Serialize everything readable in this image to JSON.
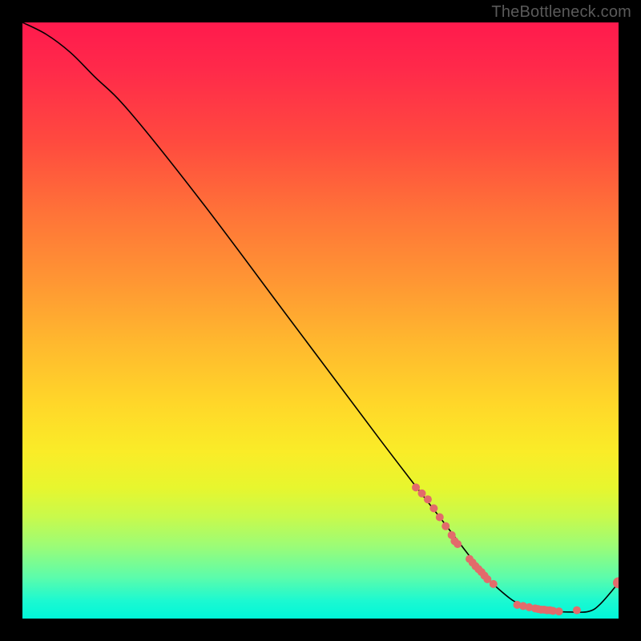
{
  "watermark": "TheBottleneck.com",
  "chart_data": {
    "type": "line",
    "title": "",
    "xlabel": "",
    "ylabel": "",
    "xlim": [
      0,
      100
    ],
    "ylim": [
      0,
      100
    ],
    "curve": {
      "x": [
        0,
        4,
        8,
        12,
        18,
        30,
        45,
        60,
        70,
        77,
        81,
        84,
        88,
        92,
        95,
        97,
        100
      ],
      "y": [
        100,
        98,
        95,
        91,
        85,
        70,
        50,
        30,
        17,
        8,
        4,
        2.2,
        1.3,
        1.1,
        1.2,
        2.5,
        6
      ]
    },
    "markers_upper": {
      "comment": "thick-dotted segment of curve in orange band",
      "x": [
        66,
        67,
        68,
        69,
        70,
        71,
        72,
        72.5,
        73,
        75,
        75.5,
        76,
        76.5,
        77,
        77.5,
        78,
        79
      ],
      "y": [
        22,
        21,
        20,
        18.5,
        17,
        15.5,
        14,
        13,
        12.5,
        10,
        9.4,
        8.8,
        8.3,
        7.8,
        7.2,
        6.6,
        5.8
      ]
    },
    "markers_flat": {
      "comment": "dotted segment along the green floor",
      "x": [
        83,
        84,
        85,
        86,
        86.5,
        87,
        87.5,
        88,
        88.5,
        89,
        90,
        93
      ],
      "y": [
        2.3,
        2.1,
        1.9,
        1.7,
        1.6,
        1.5,
        1.5,
        1.4,
        1.4,
        1.3,
        1.2,
        1.4
      ]
    },
    "marker_end": {
      "x": 100,
      "y": 6
    },
    "marker_color": "#e26b6b",
    "marker_radius_small": 5,
    "marker_radius_end": 7,
    "line_color": "#000000",
    "line_width": 1.6
  }
}
